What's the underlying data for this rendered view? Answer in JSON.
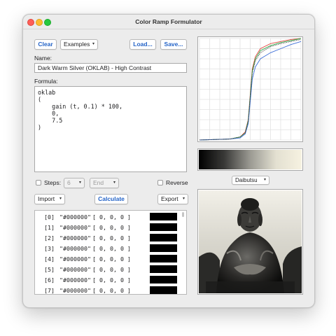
{
  "window": {
    "title": "Color Ramp Formulator"
  },
  "toolbar": {
    "clear": "Clear",
    "examples": "Examples",
    "load": "Load...",
    "save": "Save..."
  },
  "name": {
    "label": "Name:",
    "value": "Dark Warm Silver (OKLAB) - High Contrast"
  },
  "formula": {
    "label": "Formula:",
    "text": "oklab\n(\n    gain (t, 0.1) * 100,\n    0,\n    7.5\n)"
  },
  "options": {
    "steps_label": "Steps:",
    "steps_value": "6",
    "end_value": "End",
    "reverse_label": "Reverse"
  },
  "actions": {
    "import": "Import",
    "calculate": "Calculate",
    "export": "Export"
  },
  "table": {
    "rows": [
      {
        "index": "[0]",
        "hex": "\"#000000\"",
        "rgb": "[ 0, 0, 0 ]"
      },
      {
        "index": "[1]",
        "hex": "\"#000000\"",
        "rgb": "[ 0, 0, 0 ]"
      },
      {
        "index": "[2]",
        "hex": "\"#000000\"",
        "rgb": "[ 0, 0, 0 ]"
      },
      {
        "index": "[3]",
        "hex": "\"#000000\"",
        "rgb": "[ 0, 0, 0 ]"
      },
      {
        "index": "[4]",
        "hex": "\"#000000\"",
        "rgb": "[ 0, 0, 0 ]"
      },
      {
        "index": "[5]",
        "hex": "\"#000000\"",
        "rgb": "[ 0, 0, 0 ]"
      },
      {
        "index": "[6]",
        "hex": "\"#000000\"",
        "rgb": "[ 0, 0, 0 ]"
      },
      {
        "index": "[7]",
        "hex": "\"#000000\"",
        "rgb": "[ 0, 0, 0 ]"
      }
    ],
    "swatch_color": "#000000"
  },
  "image_selector": {
    "value": "Daibutsu"
  },
  "chart_data": {
    "type": "line",
    "xlim": [
      0,
      1
    ],
    "ylim": [
      0,
      1
    ],
    "grid": true,
    "legend": "none",
    "series": [
      {
        "color": "#e0443e",
        "x": [
          0,
          0.3,
          0.4,
          0.45,
          0.48,
          0.5,
          0.52,
          0.55,
          0.6,
          0.7,
          0.8,
          0.9,
          1
        ],
        "y": [
          0,
          0.01,
          0.03,
          0.08,
          0.2,
          0.45,
          0.7,
          0.82,
          0.9,
          0.95,
          0.97,
          0.99,
          1
        ]
      },
      {
        "color": "#2eaa46",
        "x": [
          0,
          0.3,
          0.4,
          0.45,
          0.48,
          0.5,
          0.52,
          0.55,
          0.6,
          0.7,
          0.8,
          0.9,
          1
        ],
        "y": [
          0,
          0.01,
          0.03,
          0.07,
          0.19,
          0.43,
          0.68,
          0.8,
          0.88,
          0.93,
          0.96,
          0.98,
          1
        ]
      },
      {
        "color": "#3e6fd8",
        "x": [
          0,
          0.3,
          0.4,
          0.45,
          0.48,
          0.5,
          0.52,
          0.55,
          0.6,
          0.7,
          0.8,
          0.9,
          1
        ],
        "y": [
          0,
          0.01,
          0.02,
          0.06,
          0.16,
          0.38,
          0.6,
          0.72,
          0.8,
          0.86,
          0.9,
          0.94,
          0.97
        ]
      },
      {
        "color": "#333333",
        "dashed": true,
        "x": [
          0,
          0.3,
          0.4,
          0.45,
          0.48,
          0.5,
          0.52,
          0.55,
          0.6,
          0.7,
          0.8,
          0.9,
          1
        ],
        "y": [
          0,
          0.01,
          0.03,
          0.07,
          0.18,
          0.42,
          0.66,
          0.78,
          0.86,
          0.92,
          0.95,
          0.97,
          0.99
        ]
      }
    ]
  },
  "ramp": {
    "colors": [
      "#000000",
      "#3a3a38",
      "#9b9a93",
      "#e3e0d1",
      "#f6f2e1"
    ]
  }
}
